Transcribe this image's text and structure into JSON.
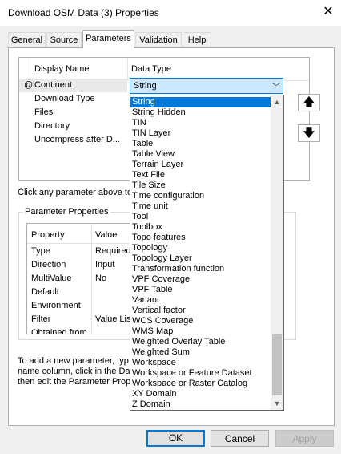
{
  "window": {
    "title": "Download OSM Data (3) Properties"
  },
  "tabs": [
    "General",
    "Source",
    "Parameters",
    "Validation",
    "Help"
  ],
  "active_tab": "Parameters",
  "grid": {
    "headers": [
      "Display Name",
      "Data Type"
    ],
    "rows": [
      {
        "marker": "@",
        "name": "Continent"
      },
      {
        "marker": "",
        "name": "Download Type"
      },
      {
        "marker": "",
        "name": "Files"
      },
      {
        "marker": "",
        "name": "Directory"
      },
      {
        "marker": "",
        "name": "Uncompress after D..."
      }
    ]
  },
  "combo": {
    "value": "String"
  },
  "dropdown_items": [
    "String",
    "String Hidden",
    "TIN",
    "TIN Layer",
    "Table",
    "Table View",
    "Terrain Layer",
    "Text File",
    "Tile Size",
    "Time configuration",
    "Time unit",
    "Tool",
    "Toolbox",
    "Topo features",
    "Topology",
    "Topology Layer",
    "Transformation function",
    "VPF Coverage",
    "VPF Table",
    "Variant",
    "Vertical factor",
    "WCS Coverage",
    "WMS Map",
    "Weighted Overlay Table",
    "Weighted Sum",
    "Workspace",
    "Workspace or Feature Dataset",
    "Workspace or Raster Catalog",
    "XY Domain",
    "Z Domain"
  ],
  "hint_text": "Click any parameter above to",
  "param_props": {
    "legend": "Parameter Properties",
    "headers": [
      "Property",
      "Value"
    ],
    "rows": [
      {
        "property": "Type",
        "value": "Required"
      },
      {
        "property": "Direction",
        "value": "Input"
      },
      {
        "property": "MultiValue",
        "value": "No"
      },
      {
        "property": "Default",
        "value": ""
      },
      {
        "property": "Environment",
        "value": ""
      },
      {
        "property": "Filter",
        "value": "Value List"
      },
      {
        "property": "Obtained from",
        "value": ""
      }
    ]
  },
  "footer_lines": [
    "To add a new parameter, typ",
    "name column, click in the Data",
    "then edit the Parameter Prop"
  ],
  "buttons": {
    "ok": "OK",
    "cancel": "Cancel",
    "apply": "Apply"
  },
  "icons": {
    "close": "close-icon",
    "up": "arrow-up-icon",
    "down": "arrow-down-icon"
  }
}
